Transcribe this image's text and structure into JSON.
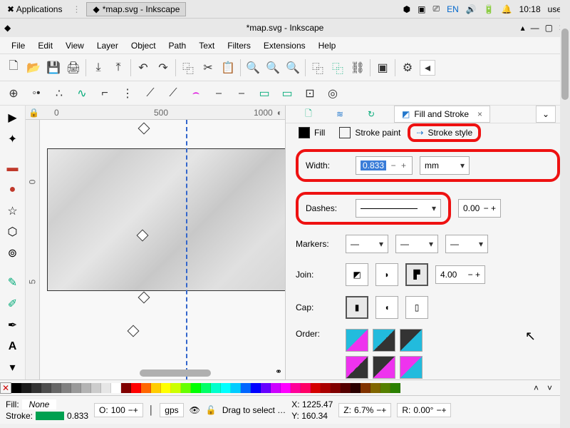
{
  "taskbar": {
    "applications": "Applications",
    "current_app": "*map.svg - Inkscape",
    "lang": "EN",
    "time": "10:18",
    "user": "user"
  },
  "window": {
    "title": "*map.svg - Inkscape"
  },
  "menu": {
    "file": "File",
    "edit": "Edit",
    "view": "View",
    "layer": "Layer",
    "object": "Object",
    "path": "Path",
    "text": "Text",
    "filters": "Filters",
    "extensions": "Extensions",
    "help": "Help"
  },
  "ruler": {
    "t0": "0",
    "t500": "500",
    "t1000": "1000",
    "v0": "0",
    "v5": "5"
  },
  "panel": {
    "title": "Fill and Stroke",
    "tabs": {
      "fill": "Fill",
      "stroke_paint": "Stroke paint",
      "stroke_style": "Stroke style"
    },
    "width_label": "Width:",
    "width_value": "0.833",
    "width_unit": "mm",
    "dashes_label": "Dashes:",
    "dashes_offset": "0.00",
    "markers_label": "Markers:",
    "join_label": "Join:",
    "join_value": "4.00",
    "cap_label": "Cap:",
    "order_label": "Order:"
  },
  "status": {
    "fill_label": "Fill:",
    "fill_value": "None",
    "stroke_label": "Stroke:",
    "stroke_value": "0.833",
    "opacity_label": "O:",
    "opacity_value": "100",
    "layer": "gps",
    "hint": "Drag to select …",
    "x_label": "X:",
    "x_value": "1225.47",
    "y_label": "Y:",
    "y_value": "160.34",
    "z_label": "Z:",
    "z_value": "6.7%",
    "r_label": "R:",
    "r_value": "0.00°"
  },
  "palette": [
    "#000000",
    "#1a1a1a",
    "#333333",
    "#4d4d4d",
    "#666666",
    "#808080",
    "#999999",
    "#b3b3b3",
    "#cccccc",
    "#e6e6e6",
    "#ffffff",
    "#800000",
    "#ff0000",
    "#ff6600",
    "#ffcc00",
    "#ffff00",
    "#ccff00",
    "#66ff00",
    "#00ff00",
    "#00ff66",
    "#00ffcc",
    "#00ffff",
    "#00ccff",
    "#0066ff",
    "#0000ff",
    "#6600ff",
    "#cc00ff",
    "#ff00ff",
    "#ff0099",
    "#ff0066",
    "#d40000",
    "#aa0000",
    "#800000",
    "#550000",
    "#2b0000",
    "#803300",
    "#806600",
    "#558000",
    "#2b8000"
  ]
}
